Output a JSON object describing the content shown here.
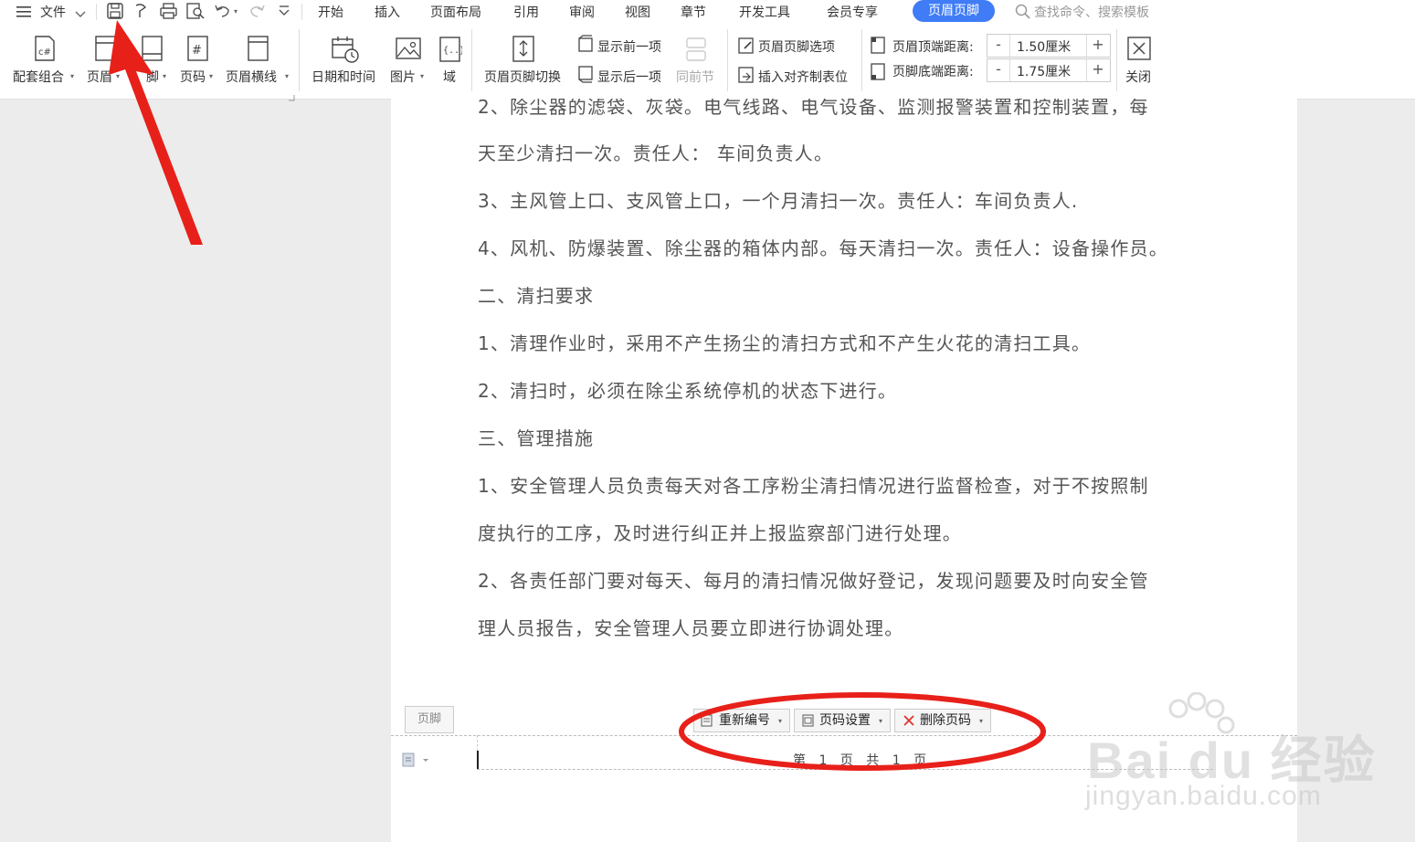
{
  "menubar": {
    "file_label": "文件",
    "tabs": [
      "开始",
      "插入",
      "页面布局",
      "引用",
      "审阅",
      "视图",
      "章节",
      "开发工具",
      "会员专享",
      "页眉页脚"
    ],
    "active_tab": "页眉页脚",
    "search_placeholder": "查找命令、搜索模板"
  },
  "ribbon": {
    "group1": [
      "配套组合",
      "页眉",
      "脚",
      "页码",
      "页眉横线"
    ],
    "group2": [
      "日期和时间",
      "图片",
      "域"
    ],
    "switch_label": "页眉页脚切换",
    "show_prev": "显示前一项",
    "show_next": "显示后一项",
    "same_prev": "同前节",
    "hf_options": "页眉页脚选项",
    "insert_tab": "插入对齐制表位",
    "header_top_label": "页眉顶端距离:",
    "header_top_value": "1.50厘米",
    "footer_bottom_label": "页脚底端距离:",
    "footer_bottom_value": "1.75厘米",
    "close_label": "关闭",
    "minus": "-",
    "plus": "+"
  },
  "document": {
    "lines": [
      "2、除尘器的滤袋、灰袋。电气线路、电气设备、监测报警装置和控制装置，每",
      "天至少清扫一次。责任人： 车间负责人。",
      "3、主风管上口、支风管上口，一个月清扫一次。责任人：车间负责人.",
      "4、风机、防爆装置、除尘器的箱体内部。每天清扫一次。责任人：设备操作员。",
      "二、清扫要求",
      "1、清理作业时，采用不产生扬尘的清扫方式和不产生火花的清扫工具。",
      "2、清扫时，必须在除尘系统停机的状态下进行。",
      "三、管理措施",
      "1、安全管理人员负责每天对各工序粉尘清扫情况进行监督检查，对于不按照制",
      "度执行的工序，及时进行纠正并上报监察部门进行处理。",
      "2、各责任部门要对每天、每月的清扫情况做好登记，发现问题要及时向安全管",
      "理人员报告，安全管理人员要立即进行协调处理。"
    ]
  },
  "footer": {
    "tag": "页脚",
    "renumber": "重新编号",
    "page_settings": "页码设置",
    "delete_page_num": "删除页码",
    "page_text": "第 1 页 共 1 页"
  },
  "watermark": {
    "brand": "Bai du 经验",
    "url": "jingyan.baidu.com"
  },
  "colors": {
    "accent": "#3f7cf6",
    "annotation_red": "#e8201a"
  }
}
